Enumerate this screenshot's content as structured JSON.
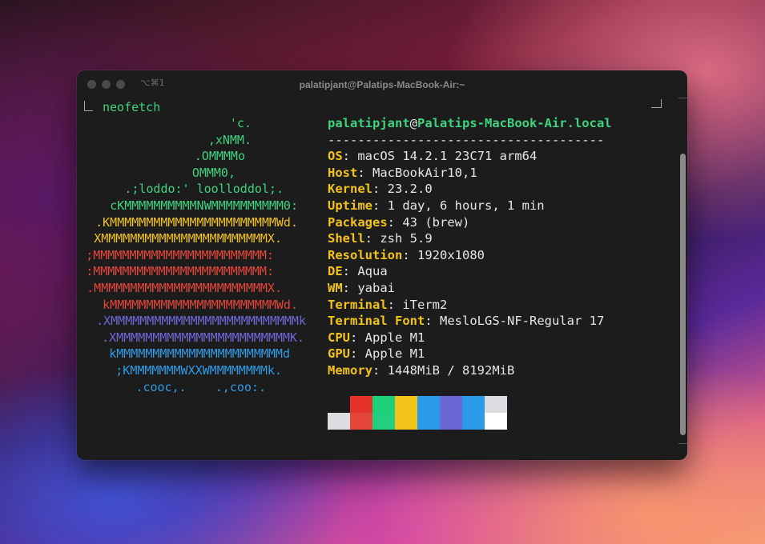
{
  "window": {
    "title": "palatipjant@Palatips-MacBook-Air:~",
    "shortcut": "⌥⌘1"
  },
  "prompt": {
    "command": "neofetch"
  },
  "ascii_art": [
    {
      "text": "'c.",
      "color": "#3fd37f"
    },
    {
      "text": ",xNMM.",
      "color": "#3fd37f"
    },
    {
      "text": ".OMMMMo",
      "color": "#3fd37f"
    },
    {
      "text": "OMMM0,",
      "color": "#3fd37f"
    },
    {
      "text": ".;loddo:' loolloddol;.",
      "color": "#3fd37f"
    },
    {
      "text": "cKMMMMMMMMMMNWMMMMMMMMMM0:",
      "color": "#3fd37f"
    },
    {
      "text": ".KMMMMMMMMMMMMMMMMMMMMMMMWd.",
      "color": "#f2c31b"
    },
    {
      "text": "XMMMMMMMMMMMMMMMMMMMMMMMX.",
      "color": "#f2c31b"
    },
    {
      "text": ";MMMMMMMMMMMMMMMMMMMMMMMM:",
      "color": "#e5463b"
    },
    {
      "text": ":MMMMMMMMMMMMMMMMMMMMMMMM:",
      "color": "#e5463b"
    },
    {
      "text": ".MMMMMMMMMMMMMMMMMMMMMMMMX.",
      "color": "#e5463b"
    },
    {
      "text": "kMMMMMMMMMMMMMMMMMMMMMMMWd.",
      "color": "#e5463b"
    },
    {
      "text": ".XMMMMMMMMMMMMMMMMMMMMMMMMMMk",
      "color": "#6f68d8"
    },
    {
      "text": ".XMMMMMMMMMMMMMMMMMMMMMMMMK.",
      "color": "#6f68d8"
    },
    {
      "text": "kMMMMMMMMMMMMMMMMMMMMMMMd",
      "color": "#2e9be6"
    },
    {
      "text": ";KMMMMMMMWXXWMMMMMMMMk.",
      "color": "#2e9be6"
    },
    {
      "text": ".cooc,.    .,coo:.",
      "color": "#2e9be6"
    }
  ],
  "info": {
    "user": "palatipjant",
    "at": "@",
    "host": "Palatips-MacBook-Air.local",
    "separator": "-------------------------------------",
    "fields": [
      {
        "key": "OS",
        "value": "macOS 14.2.1 23C71 arm64"
      },
      {
        "key": "Host",
        "value": "MacBookAir10,1"
      },
      {
        "key": "Kernel",
        "value": "23.2.0"
      },
      {
        "key": "Uptime",
        "value": "1 day, 6 hours, 1 min"
      },
      {
        "key": "Packages",
        "value": "43 (brew)"
      },
      {
        "key": "Shell",
        "value": "zsh 5.9"
      },
      {
        "key": "Resolution",
        "value": "1920x1080"
      },
      {
        "key": "DE",
        "value": "Aqua"
      },
      {
        "key": "WM",
        "value": "yabai"
      },
      {
        "key": "Terminal",
        "value": "iTerm2"
      },
      {
        "key": "Terminal Font",
        "value": "MesloLGS-NF-Regular 17"
      },
      {
        "key": "CPU",
        "value": "Apple M1"
      },
      {
        "key": "GPU",
        "value": "Apple M1"
      },
      {
        "key": "Memory",
        "value": "1448MiB / 8192MiB"
      }
    ],
    "separator_after_key": ": "
  },
  "palette": {
    "top": [
      "#1c1c1c",
      "#e5322a",
      "#1fd07a",
      "#f2c31b",
      "#2a9be8",
      "#6b68d6",
      "#2a9be8",
      "#dcdde0"
    ],
    "bottom": [
      "#dcdde0",
      "#e5463b",
      "#22cf80",
      "#f2c31b",
      "#2a9be8",
      "#6b68d6",
      "#2a9be8",
      "#ffffff"
    ]
  }
}
